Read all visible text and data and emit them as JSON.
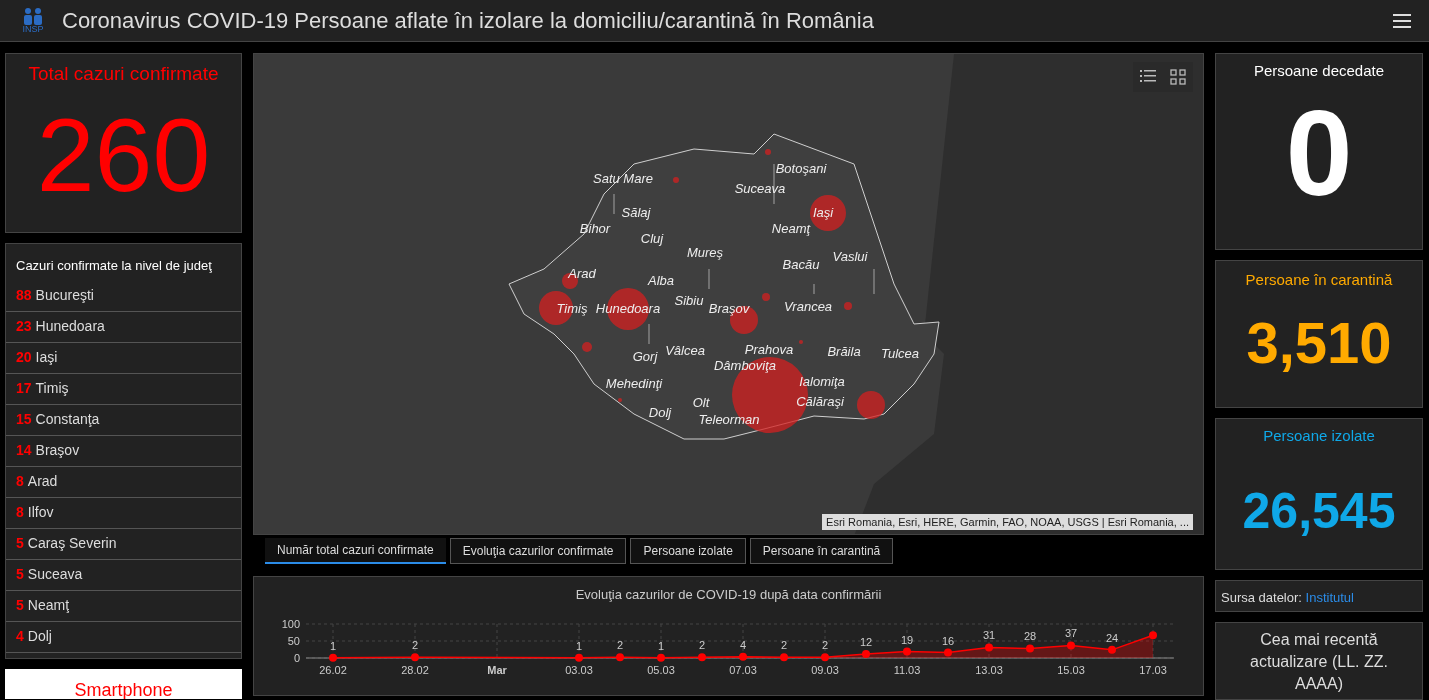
{
  "header": {
    "title": "Coronavirus COVID-19 Persoane aflate în izolare la domiciliu/carantină în România",
    "logo_text": "INSP"
  },
  "total": {
    "title": "Total cazuri confirmate",
    "value": "260"
  },
  "county_list": {
    "title": "Cazuri confirmate la nivel de judeţ",
    "items": [
      {
        "count": "88",
        "name": "Bucureşti"
      },
      {
        "count": "23",
        "name": "Hunedoara"
      },
      {
        "count": "20",
        "name": "Iaşi"
      },
      {
        "count": "17",
        "name": "Timiş"
      },
      {
        "count": "15",
        "name": "Constanţa"
      },
      {
        "count": "14",
        "name": "Braşov"
      },
      {
        "count": "8",
        "name": "Arad"
      },
      {
        "count": "8",
        "name": "Ilfov"
      },
      {
        "count": "5",
        "name": "Caraş Severin"
      },
      {
        "count": "5",
        "name": "Suceava"
      },
      {
        "count": "5",
        "name": "Neamţ"
      },
      {
        "count": "4",
        "name": "Dolj"
      }
    ]
  },
  "smartphone_button": "Smartphone",
  "map": {
    "labels": [
      "Botoşani",
      "Satu Mare",
      "Suceava",
      "Iaşi",
      "Sălaj",
      "Neamţ",
      "Bihor",
      "Cluj",
      "Mureş",
      "Vaslui",
      "Bacău",
      "Arad",
      "Alba",
      "Timiş",
      "Hunedoara",
      "Sibiu",
      "Braşov",
      "Vrancea",
      "Prahova",
      "Gorj",
      "Vâlcea",
      "Brăila",
      "Tulcea",
      "Dâmboviţa",
      "Mehedinţi",
      "Ialomiţa",
      "Călăraşi",
      "Olt",
      "Dolj",
      "Teleorman"
    ],
    "attribution": "Esri Romania, Esri, HERE, Garmin, FAO, NOAA, USGS | Esri Romania, ..."
  },
  "tabs": [
    {
      "label": "Număr total cazuri confirmate",
      "selected": true
    },
    {
      "label": "Evoluţia cazurilor confirmate",
      "selected": false
    },
    {
      "label": "Persoane izolate",
      "selected": false
    },
    {
      "label": "Persoane în carantină",
      "selected": false
    }
  ],
  "chart": {
    "chart_data": {
      "type": "area",
      "title": "Evoluţia cazurilor de COVID-19 după data confirmării",
      "categories": [
        "26.02",
        null,
        "28.02",
        null,
        "Mar",
        null,
        "03.03",
        null,
        "05.03",
        null,
        "07.03",
        null,
        "09.03",
        null,
        "11.03",
        null,
        "13.03",
        null,
        "15.03",
        null,
        "17.03"
      ],
      "series": [
        {
          "color": "#ff0000",
          "values": [
            1,
            null,
            2,
            null,
            null,
            null,
            1,
            2,
            1,
            2,
            4,
            2,
            2,
            12,
            19,
            16,
            31,
            28,
            37,
            24,
            67
          ]
        }
      ],
      "value_labels": [
        "1",
        null,
        "2",
        null,
        null,
        null,
        "1",
        "2",
        "1",
        "2",
        "4",
        "2",
        "2",
        "12",
        "19",
        "16",
        "31",
        "28",
        "37",
        "24",
        null
      ],
      "ylim": [
        0,
        100
      ],
      "yticks": [
        0,
        50,
        100
      ],
      "grid": true
    }
  },
  "stats": [
    {
      "title": "Persoane decedate",
      "value": "0",
      "color": "#ffffff"
    },
    {
      "title": "Persoane în carantină",
      "value": "3,510",
      "color": "#ffaa00"
    },
    {
      "title": "Persoane izolate",
      "value": "26,545",
      "color": "#0fa8e8"
    }
  ],
  "source": {
    "text": "Sursa datelor:",
    "link": "Institutul"
  },
  "update": {
    "text": "Cea mai recentă actualizare (LL. ZZ. AAAA)"
  }
}
